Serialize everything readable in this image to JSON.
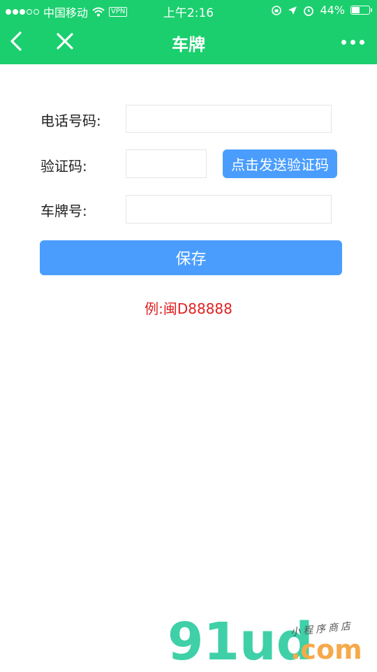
{
  "status_bar": {
    "carrier": "中国移动",
    "vpn": "VPN",
    "time": "上午2:16",
    "battery": "44%",
    "battery_level": 0.44
  },
  "nav": {
    "title": "车牌"
  },
  "form": {
    "phone_label": "电话号码:",
    "phone_value": "",
    "code_label": "验证码:",
    "code_value": "",
    "send_code_label": "点击发送验证码",
    "plate_label": "车牌号:",
    "plate_value": "",
    "save_label": "保存",
    "example_text": "例:闽D88888"
  },
  "watermark": {
    "logo_text": "91ud",
    "domain": ".com",
    "tagline": "小程序商店"
  },
  "colors": {
    "header_green": "#1bcf6e",
    "button_blue": "#4a9dfd",
    "example_red": "#e02020"
  }
}
